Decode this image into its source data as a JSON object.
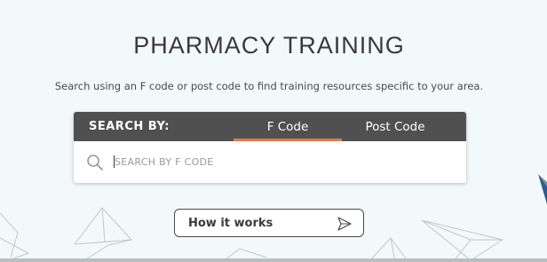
{
  "header": {
    "title": "PHARMACY TRAINING",
    "subtitle": "Search using an F code or post code to find training resources specific to your area."
  },
  "search": {
    "by_label": "SEARCH BY:",
    "tabs": [
      {
        "label": "F Code",
        "active": true
      },
      {
        "label": "Post Code",
        "active": false
      }
    ],
    "placeholder": "SEARCH BY F CODE",
    "value": ""
  },
  "actions": {
    "how_it_works_label": "How it works"
  },
  "colors": {
    "page_background": "#f3f9fa",
    "search_bar": "#505050",
    "active_tab_underline": "#e07a4a",
    "decoration_accent": "#2f5b8f"
  },
  "icons": {
    "search": "search-icon",
    "how_it_works": "send-arrow-icon"
  }
}
